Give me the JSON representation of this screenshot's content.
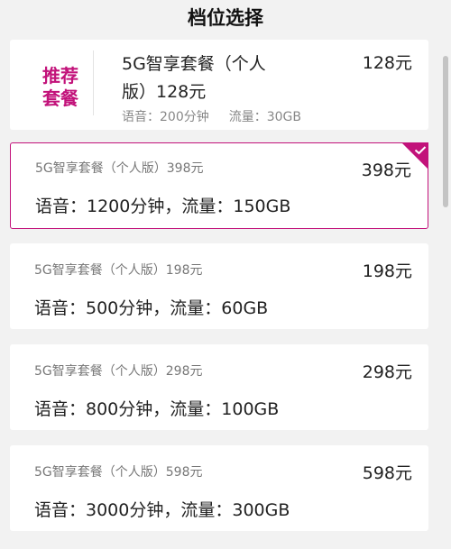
{
  "header": {
    "title": "档位选择"
  },
  "recommended": {
    "badge_line1": "推荐",
    "badge_line2": "套餐",
    "name_line1": "5G智享套餐（个人",
    "name_line2": "版）128元",
    "voice": "语音：200分钟",
    "data": "流量：30GB",
    "price": "128元"
  },
  "plans": [
    {
      "name": "5G智享套餐（个人版）398元",
      "features": "语音：1200分钟，流量：150GB",
      "price": "398元",
      "selected": true
    },
    {
      "name": "5G智享套餐（个人版）198元",
      "features": "语音：500分钟，流量：60GB",
      "price": "198元",
      "selected": false
    },
    {
      "name": "5G智享套餐（个人版）298元",
      "features": "语音：800分钟，流量：100GB",
      "price": "298元",
      "selected": false
    },
    {
      "name": "5G智享套餐（个人版）598元",
      "features": "语音：3000分钟，流量：300GB",
      "price": "598元",
      "selected": false
    }
  ],
  "colors": {
    "accent": "#c2127a",
    "background": "#f2f2f2",
    "card": "#ffffff"
  }
}
